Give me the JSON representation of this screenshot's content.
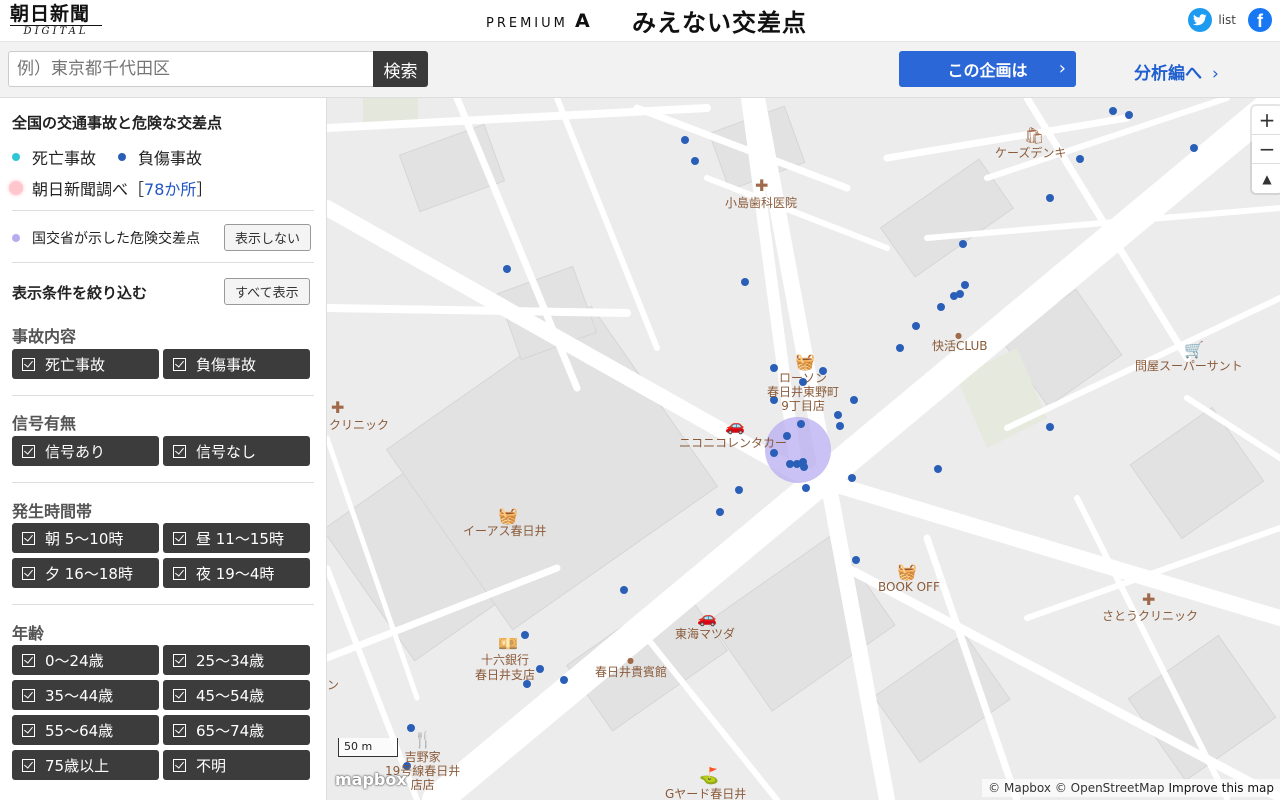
{
  "header": {
    "logo_line1": "朝日新聞",
    "logo_line2": "DIGITAL",
    "premium_text": "PREMIUM",
    "premium_mark": "A",
    "title_prefix": "みえない",
    "title_main": "交差点",
    "twitter_label": "list"
  },
  "search": {
    "placeholder": "例）東京都千代田区",
    "button_label": "検索"
  },
  "nav": {
    "plan_label": "この企画は",
    "analysis_label": "分析編へ"
  },
  "panel": {
    "title": "全国の交通事故と危険な交差点",
    "legend_death": "死亡事故",
    "legend_injury": "負傷事故",
    "legend_asahi_prefix": "朝日新聞調べ［",
    "legend_asahi_count": "78か所",
    "legend_asahi_suffix": "］",
    "mlit_label": "国交省が示した危険交差点",
    "mlit_toggle": "表示しない",
    "filter_title": "表示条件を絞り込む",
    "show_all": "すべて表示",
    "sections": [
      {
        "title": "事故内容",
        "options": [
          "死亡事故",
          "負傷事故"
        ]
      },
      {
        "title": "信号有無",
        "options": [
          "信号あり",
          "信号なし"
        ]
      },
      {
        "title": "発生時間帯",
        "options": [
          "朝 5〜10時",
          "昼 11〜15時",
          "夕 16〜18時",
          "夜 19〜4時"
        ]
      },
      {
        "title": "年齢",
        "options": [
          "0〜24歳",
          "25〜34歳",
          "35〜44歳",
          "45〜54歳",
          "55〜64歳",
          "65〜74歳",
          "75歳以上",
          "不明"
        ]
      }
    ]
  },
  "map": {
    "pois": {
      "kojima": "小島歯科医院",
      "kazudenki": "ケーズデンキ",
      "kaikatsu": "快活CLUB",
      "tonya": "問屋スーパーサント",
      "lawson": "ローソン\n春日井東野町\n9丁目店",
      "nikoniko": "ニコニコレンタカー",
      "clinic_left": "クリニック",
      "aeon": "イーアス春日井",
      "bookoff": "BOOK OFF",
      "sato": "さとうクリニック",
      "tokai": "東海マツダ",
      "juroku": "十六銀行\n春日井支店",
      "kihinkan": "春日井貴賓館",
      "yoshinoya": "吉野家\n19号線春日井\n店店",
      "gyard": "Gヤード春日井",
      "left_edge": "ン"
    },
    "scale_label": "50 m",
    "mapbox_label": "mapbox",
    "attribution": "© Mapbox © OpenStreetMap",
    "improve": "Improve this map",
    "colors": {
      "injury": "#2a5fb8",
      "hotspot": "#b8acf1"
    }
  }
}
